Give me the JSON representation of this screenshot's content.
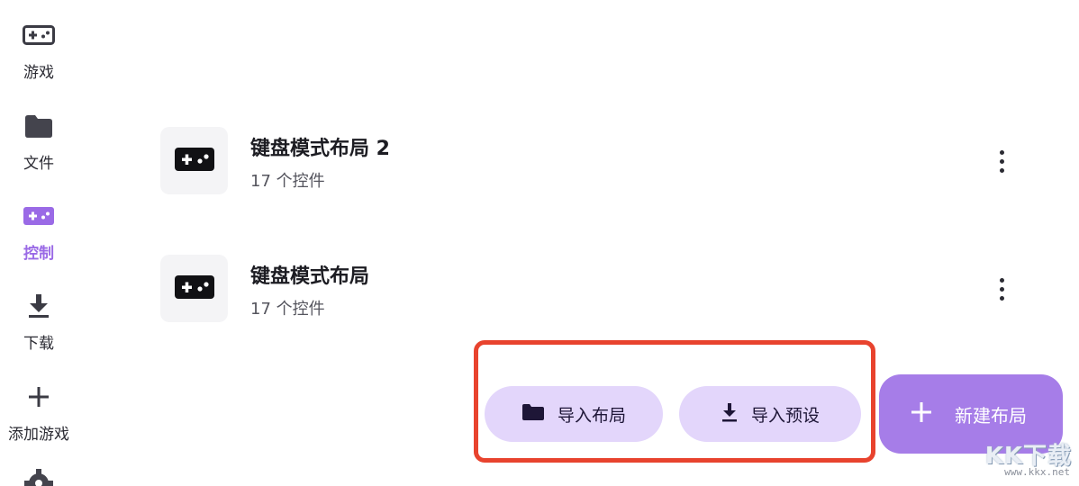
{
  "sidebar": {
    "items": [
      {
        "label": "游戏",
        "icon": "gamepad-icon"
      },
      {
        "label": "文件",
        "icon": "folder-icon"
      },
      {
        "label": "控制",
        "icon": "gamepad-icon",
        "active": true
      },
      {
        "label": "下载",
        "icon": "download-icon"
      },
      {
        "label": "添加游戏",
        "icon": "plus-icon"
      },
      {
        "label": "",
        "icon": "gear-icon"
      }
    ]
  },
  "layouts": [
    {
      "title": "键盘模式布局 2",
      "subtitle": "17 个控件",
      "icon": "gamepad-icon"
    },
    {
      "title": "键盘模式布局",
      "subtitle": "17 个控件",
      "icon": "gamepad-icon"
    }
  ],
  "actions": {
    "import_layout": "导入布局",
    "import_preset": "导入预设",
    "new_layout": "新建布局"
  },
  "watermark": {
    "title": "KK下载",
    "url": "www.kkx.net"
  },
  "colors": {
    "accent": "#9a6ae6",
    "fab": "#a67de8",
    "pill": "#e3d6fb",
    "highlight": "#e8432e"
  }
}
